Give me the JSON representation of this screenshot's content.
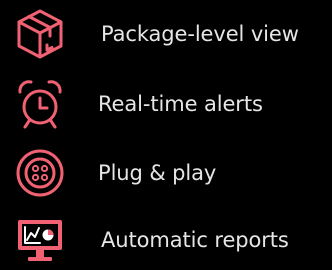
{
  "accent": "#f06273",
  "features": [
    {
      "icon": "package-box-icon",
      "label": "Package-level view"
    },
    {
      "icon": "alarm-clock-icon",
      "label": "Real-time alerts"
    },
    {
      "icon": "button-icon",
      "label": "Plug & play"
    },
    {
      "icon": "report-monitor-icon",
      "label": "Automatic reports"
    }
  ]
}
